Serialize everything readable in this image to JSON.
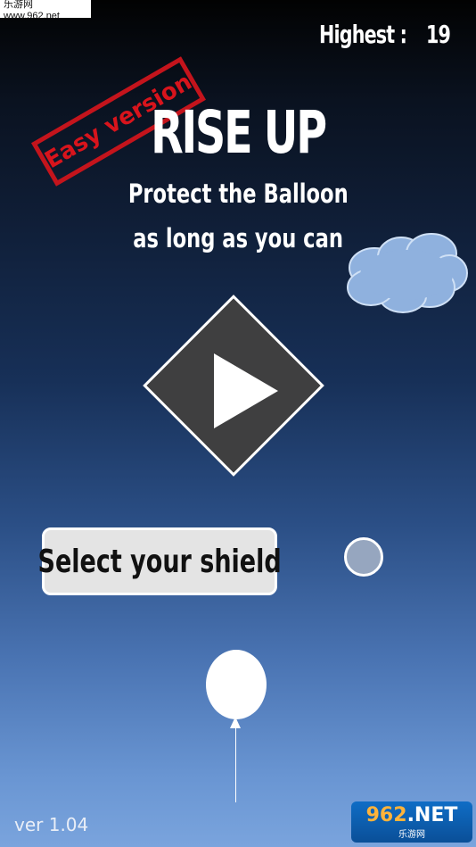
{
  "watermark_top": "乐游网 www.962.net",
  "score": {
    "label": "Highest :",
    "value": "19"
  },
  "badge": "Easy version",
  "title": "RISE UP",
  "subtitle": [
    "Protect the Balloon",
    "as long as you can"
  ],
  "shield_button": "Select your shield",
  "version": "ver 1.04",
  "watermark_bottom": {
    "highlight": "962",
    "rest": ".NET",
    "sub": "乐游网"
  },
  "icons": {
    "play": "play-icon",
    "cloud": "cloud-icon",
    "shield": "shield-dot-icon",
    "balloon": "balloon-icon"
  },
  "colors": {
    "badge_red": "#d8141c",
    "button_dark": "#3f3f40",
    "shield_dot": "#96a6bf",
    "cloud": "#8fb1de"
  }
}
